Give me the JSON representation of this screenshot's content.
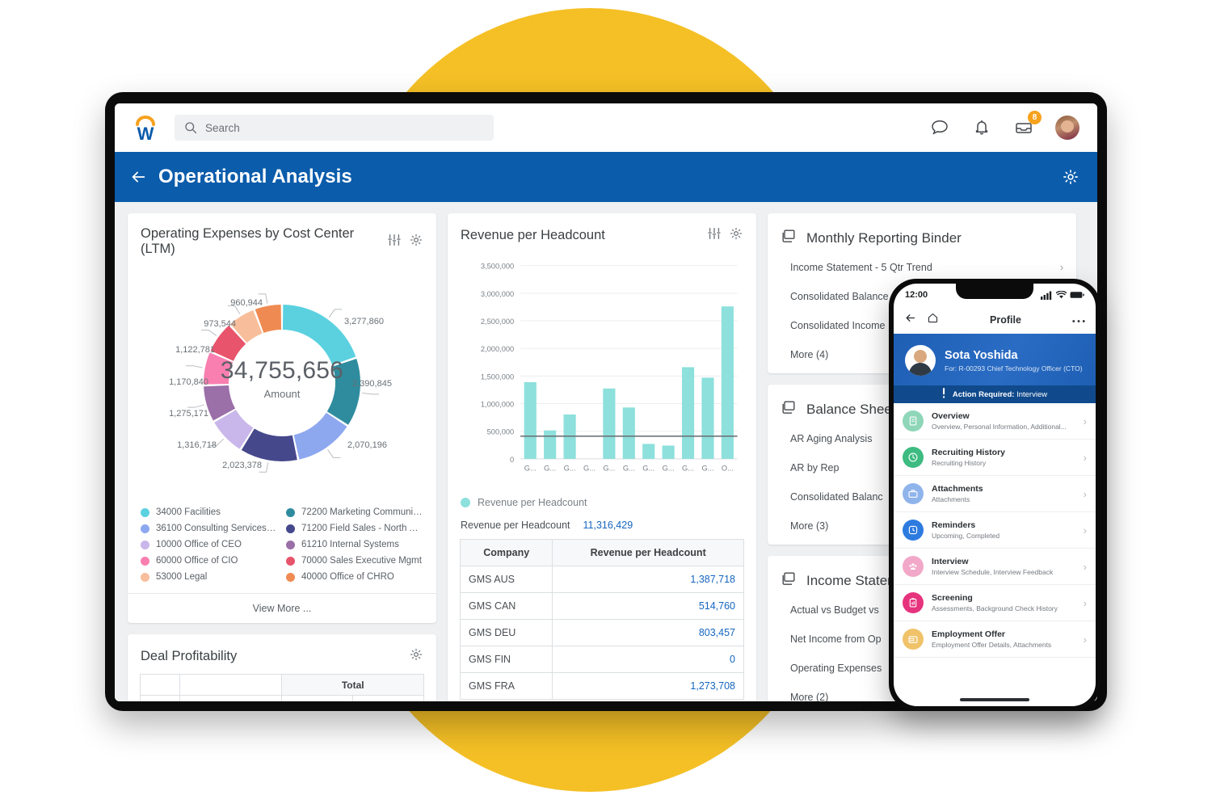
{
  "topbar": {
    "logo": "workday-logo",
    "search_placeholder": "Search",
    "icons": [
      "chat-icon",
      "bell-icon",
      "inbox-icon"
    ],
    "inbox_badge": "8"
  },
  "page_header": {
    "back": "back-arrow-icon",
    "title": "Operational Analysis",
    "gear": "gear-icon"
  },
  "expenses_card": {
    "title": "Operating Expenses by Cost Center (LTM)",
    "center_value": "34,755,656",
    "center_label": "Amount",
    "view_more": "View More ...",
    "legend": [
      {
        "label": "34000 Facilities",
        "color": "#5BD1E0"
      },
      {
        "label": "72200 Marketing Communicat...",
        "color": "#2F8C9E"
      },
      {
        "label": "36100 Consulting Services - N...",
        "color": "#8EA8F0"
      },
      {
        "label": "71200 Field Sales - North Ame...",
        "color": "#46488C"
      },
      {
        "label": "10000 Office of CEO",
        "color": "#C9B6EA"
      },
      {
        "label": "61210 Internal Systems",
        "color": "#9B6FA8"
      },
      {
        "label": "60000 Office of CIO",
        "color": "#F97FB0"
      },
      {
        "label": "70000 Sales Executive Mgmt",
        "color": "#E8546B"
      },
      {
        "label": "53000 Legal",
        "color": "#F8BE9B"
      },
      {
        "label": "40000 Office of CHRO",
        "color": "#EF8B52"
      }
    ]
  },
  "revenue_card": {
    "title": "Revenue per Headcount",
    "legend_label": "Revenue per Headcount",
    "kpi_label": "Revenue per Headcount",
    "kpi_value": "11,316,429",
    "table": {
      "headers": [
        "Company",
        "Revenue per Headcount"
      ],
      "rows": [
        [
          "GMS AUS",
          "1,387,718"
        ],
        [
          "GMS CAN",
          "514,760"
        ],
        [
          "GMS DEU",
          "803,457"
        ],
        [
          "GMS FIN",
          "0"
        ],
        [
          "GMS FRA",
          "1,273,708"
        ]
      ]
    }
  },
  "chart_data": [
    {
      "type": "pie",
      "title": "Operating Expenses by Cost Center (LTM)",
      "center_total": "34,755,656",
      "center_label": "Amount",
      "total": 34755656,
      "labels": [
        "34000 Facilities",
        "72200 Marketing Communicat...",
        "36100 Consulting Services - N...",
        "71200 Field Sales - North Ame...",
        "10000 Office of CEO",
        "61210 Internal Systems",
        "60000 Office of CIO",
        "70000 Sales Executive Mgmt",
        "53000 Legal",
        "40000 Office of CHRO"
      ],
      "values": [
        3277860,
        2390845,
        2070196,
        2023378,
        1316718,
        1275171,
        1170840,
        1122781,
        973544,
        960944
      ],
      "value_labels": [
        "3,277,860",
        "2,390,845",
        "2,070,196",
        "2,023,378",
        "1,316,718",
        "1,275,171",
        "1,170,840",
        "1,122,781",
        "973,544",
        "960,944"
      ],
      "colors": [
        "#5BD1E0",
        "#2F8C9E",
        "#8EA8F0",
        "#46488C",
        "#C9B6EA",
        "#9B6FA8",
        "#F97FB0",
        "#E8546B",
        "#F8BE9B",
        "#EF8B52"
      ],
      "legend_position": "bottom",
      "grid": false
    },
    {
      "type": "bar",
      "title": "Revenue per Headcount",
      "categories": [
        "G...",
        "G...",
        "G...",
        "G...",
        "G...",
        "G...",
        "G...",
        "G...",
        "G...",
        "G...",
        "O..."
      ],
      "values": [
        1387718,
        514760,
        803457,
        0,
        1273708,
        930000,
        270000,
        240000,
        1660000,
        1470000,
        2760000
      ],
      "series": [
        {
          "name": "Revenue per Headcount",
          "values": [
            1387718,
            514760,
            803457,
            0,
            1273708,
            930000,
            270000,
            240000,
            1660000,
            1470000,
            2760000
          ]
        }
      ],
      "reference_line": 410000,
      "bar_color": "#8DE0DC",
      "xlabel": "",
      "ylabel": "",
      "ylim": [
        0,
        3500000
      ],
      "yticks": [
        0,
        500000,
        1000000,
        1500000,
        2000000,
        2500000,
        3000000,
        3500000
      ],
      "ytick_labels": [
        "0",
        "500,000",
        "1,000,000",
        "1,500,000",
        "2,000,000",
        "2,500,000",
        "3,000,000",
        "3,500,000"
      ],
      "grid": true,
      "legend_position": "bottom"
    }
  ],
  "binders": [
    {
      "title": "Monthly Reporting Binder",
      "items": [
        "Income Statement - 5 Qtr Trend",
        "Consolidated Balance S",
        "Consolidated Income"
      ],
      "more": "More (4)"
    },
    {
      "title": "Balance Sheet",
      "items": [
        "AR Aging Analysis",
        "AR by Rep",
        "Consolidated Balanc"
      ],
      "more": "More (3)"
    },
    {
      "title": "Income Statem",
      "items": [
        "Actual vs Budget vs ",
        "Net Income from Op",
        "Operating Expenses"
      ],
      "more": "More (2)"
    }
  ],
  "deal_card": {
    "title": "Deal Profitability",
    "total_header": "Total"
  },
  "phone": {
    "status_time": "12:00",
    "nav": {
      "back": "back-arrow-icon",
      "home": "home-icon",
      "title": "Profile",
      "more": "more-icon"
    },
    "hero": {
      "name": "Sota Yoshida",
      "subtitle": "For: R-00293 Chief Technology Officer (CTO)"
    },
    "action_bar": {
      "prefix": "Action Required:",
      "value": "Interview"
    },
    "rows": [
      {
        "title": "Overview",
        "subtitle": "Overview, Personal Information, Additional...",
        "icon": "document-icon",
        "color": "#8FD6B9"
      },
      {
        "title": "Recruiting History",
        "subtitle": "Recruiting History",
        "icon": "clock-icon",
        "color": "#3DBB80"
      },
      {
        "title": "Attachments",
        "subtitle": "Attachments",
        "icon": "briefcase-icon",
        "color": "#8FB4EC"
      },
      {
        "title": "Reminders",
        "subtitle": "Upcoming, Completed",
        "icon": "alarm-icon",
        "color": "#2E7BE0"
      },
      {
        "title": "Interview",
        "subtitle": "Interview Schedule, Interview Feedback",
        "icon": "people-icon",
        "color": "#F2A8C8"
      },
      {
        "title": "Screening",
        "subtitle": "Assessments, Background Check History",
        "icon": "clipboard-icon",
        "color": "#E6337E"
      },
      {
        "title": "Employment Offer",
        "subtitle": "Employment Offer Details, Attachments",
        "icon": "wallet-icon",
        "color": "#F0C36A"
      }
    ]
  },
  "theme": {
    "brand_blue": "#0B5CAB",
    "accent_yellow": "#F5C026",
    "link_blue": "#1565C0"
  }
}
